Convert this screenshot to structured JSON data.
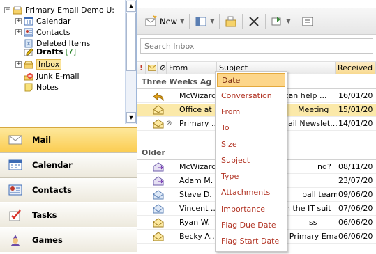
{
  "tree": {
    "items": [
      {
        "label": "Primary Email Demo U:",
        "expander": "⊟",
        "icon": "mailbox-icon"
      },
      {
        "label": "Calendar",
        "expander": "⊞",
        "icon": "calendar-icon"
      },
      {
        "label": "Contacts",
        "expander": "⊞",
        "icon": "contacts-icon"
      },
      {
        "label": "Deleted Items",
        "icon": "deleted-items-icon"
      },
      {
        "label": "Drafts",
        "count": "[7]",
        "icon": "drafts-icon"
      },
      {
        "label": "Inbox",
        "expander": "⊞",
        "icon": "inbox-icon"
      },
      {
        "label": "Junk E-mail",
        "icon": "junk-icon"
      },
      {
        "label": "Notes",
        "icon": "notes-icon"
      }
    ]
  },
  "nav": {
    "items": [
      {
        "label": "Mail",
        "icon": "mail-icon",
        "active": true
      },
      {
        "label": "Calendar",
        "icon": "calendar-icon"
      },
      {
        "label": "Contacts",
        "icon": "contacts-icon"
      },
      {
        "label": "Tasks",
        "icon": "tasks-icon"
      },
      {
        "label": "Games",
        "icon": "games-icon"
      }
    ]
  },
  "toolbar": {
    "new_label": "New"
  },
  "search": {
    "placeholder": "Search Inbox"
  },
  "columns": {
    "from": "From",
    "subject": "Subject",
    "received": "Received"
  },
  "groups": {
    "three_weeks": "Three Weeks Ag",
    "older": "Older"
  },
  "messages_recent": [
    {
      "from": "McWizard",
      "subject": "u can help ...",
      "received": "16/01/20"
    },
    {
      "from": "Office at",
      "subject": "Meeting",
      "received": "15/01/20"
    },
    {
      "from": "Primary ...",
      "subject": "ail Newslet...",
      "received": "14/01/20"
    }
  ],
  "messages_older": [
    {
      "from": "McWizard",
      "subject": "nd?",
      "received": "08/11/20"
    },
    {
      "from": "Adam M.",
      "subject": "",
      "received": "23/07/20"
    },
    {
      "from": "Steve D.",
      "subject": "ball team",
      "received": "09/06/20"
    },
    {
      "from": "Vincent ...",
      "subject": "n the IT suit",
      "received": "07/06/20"
    },
    {
      "from": "Ryan W.",
      "subject": "ss",
      "received": "06/06/20"
    },
    {
      "from": "Becky A...",
      "subject": "RE: Primary Email",
      "received": "06/06/20"
    }
  ],
  "menu": {
    "items": [
      "Date",
      "Conversation",
      "From",
      "To",
      "Size",
      "Subject",
      "Type",
      "Attachments",
      "Importance",
      "Flag Due Date",
      "Flag Start Date"
    ]
  },
  "colors": {
    "accent": "#fbcd52",
    "selection": "#fbe9a9",
    "menu_text": "#b03020"
  }
}
